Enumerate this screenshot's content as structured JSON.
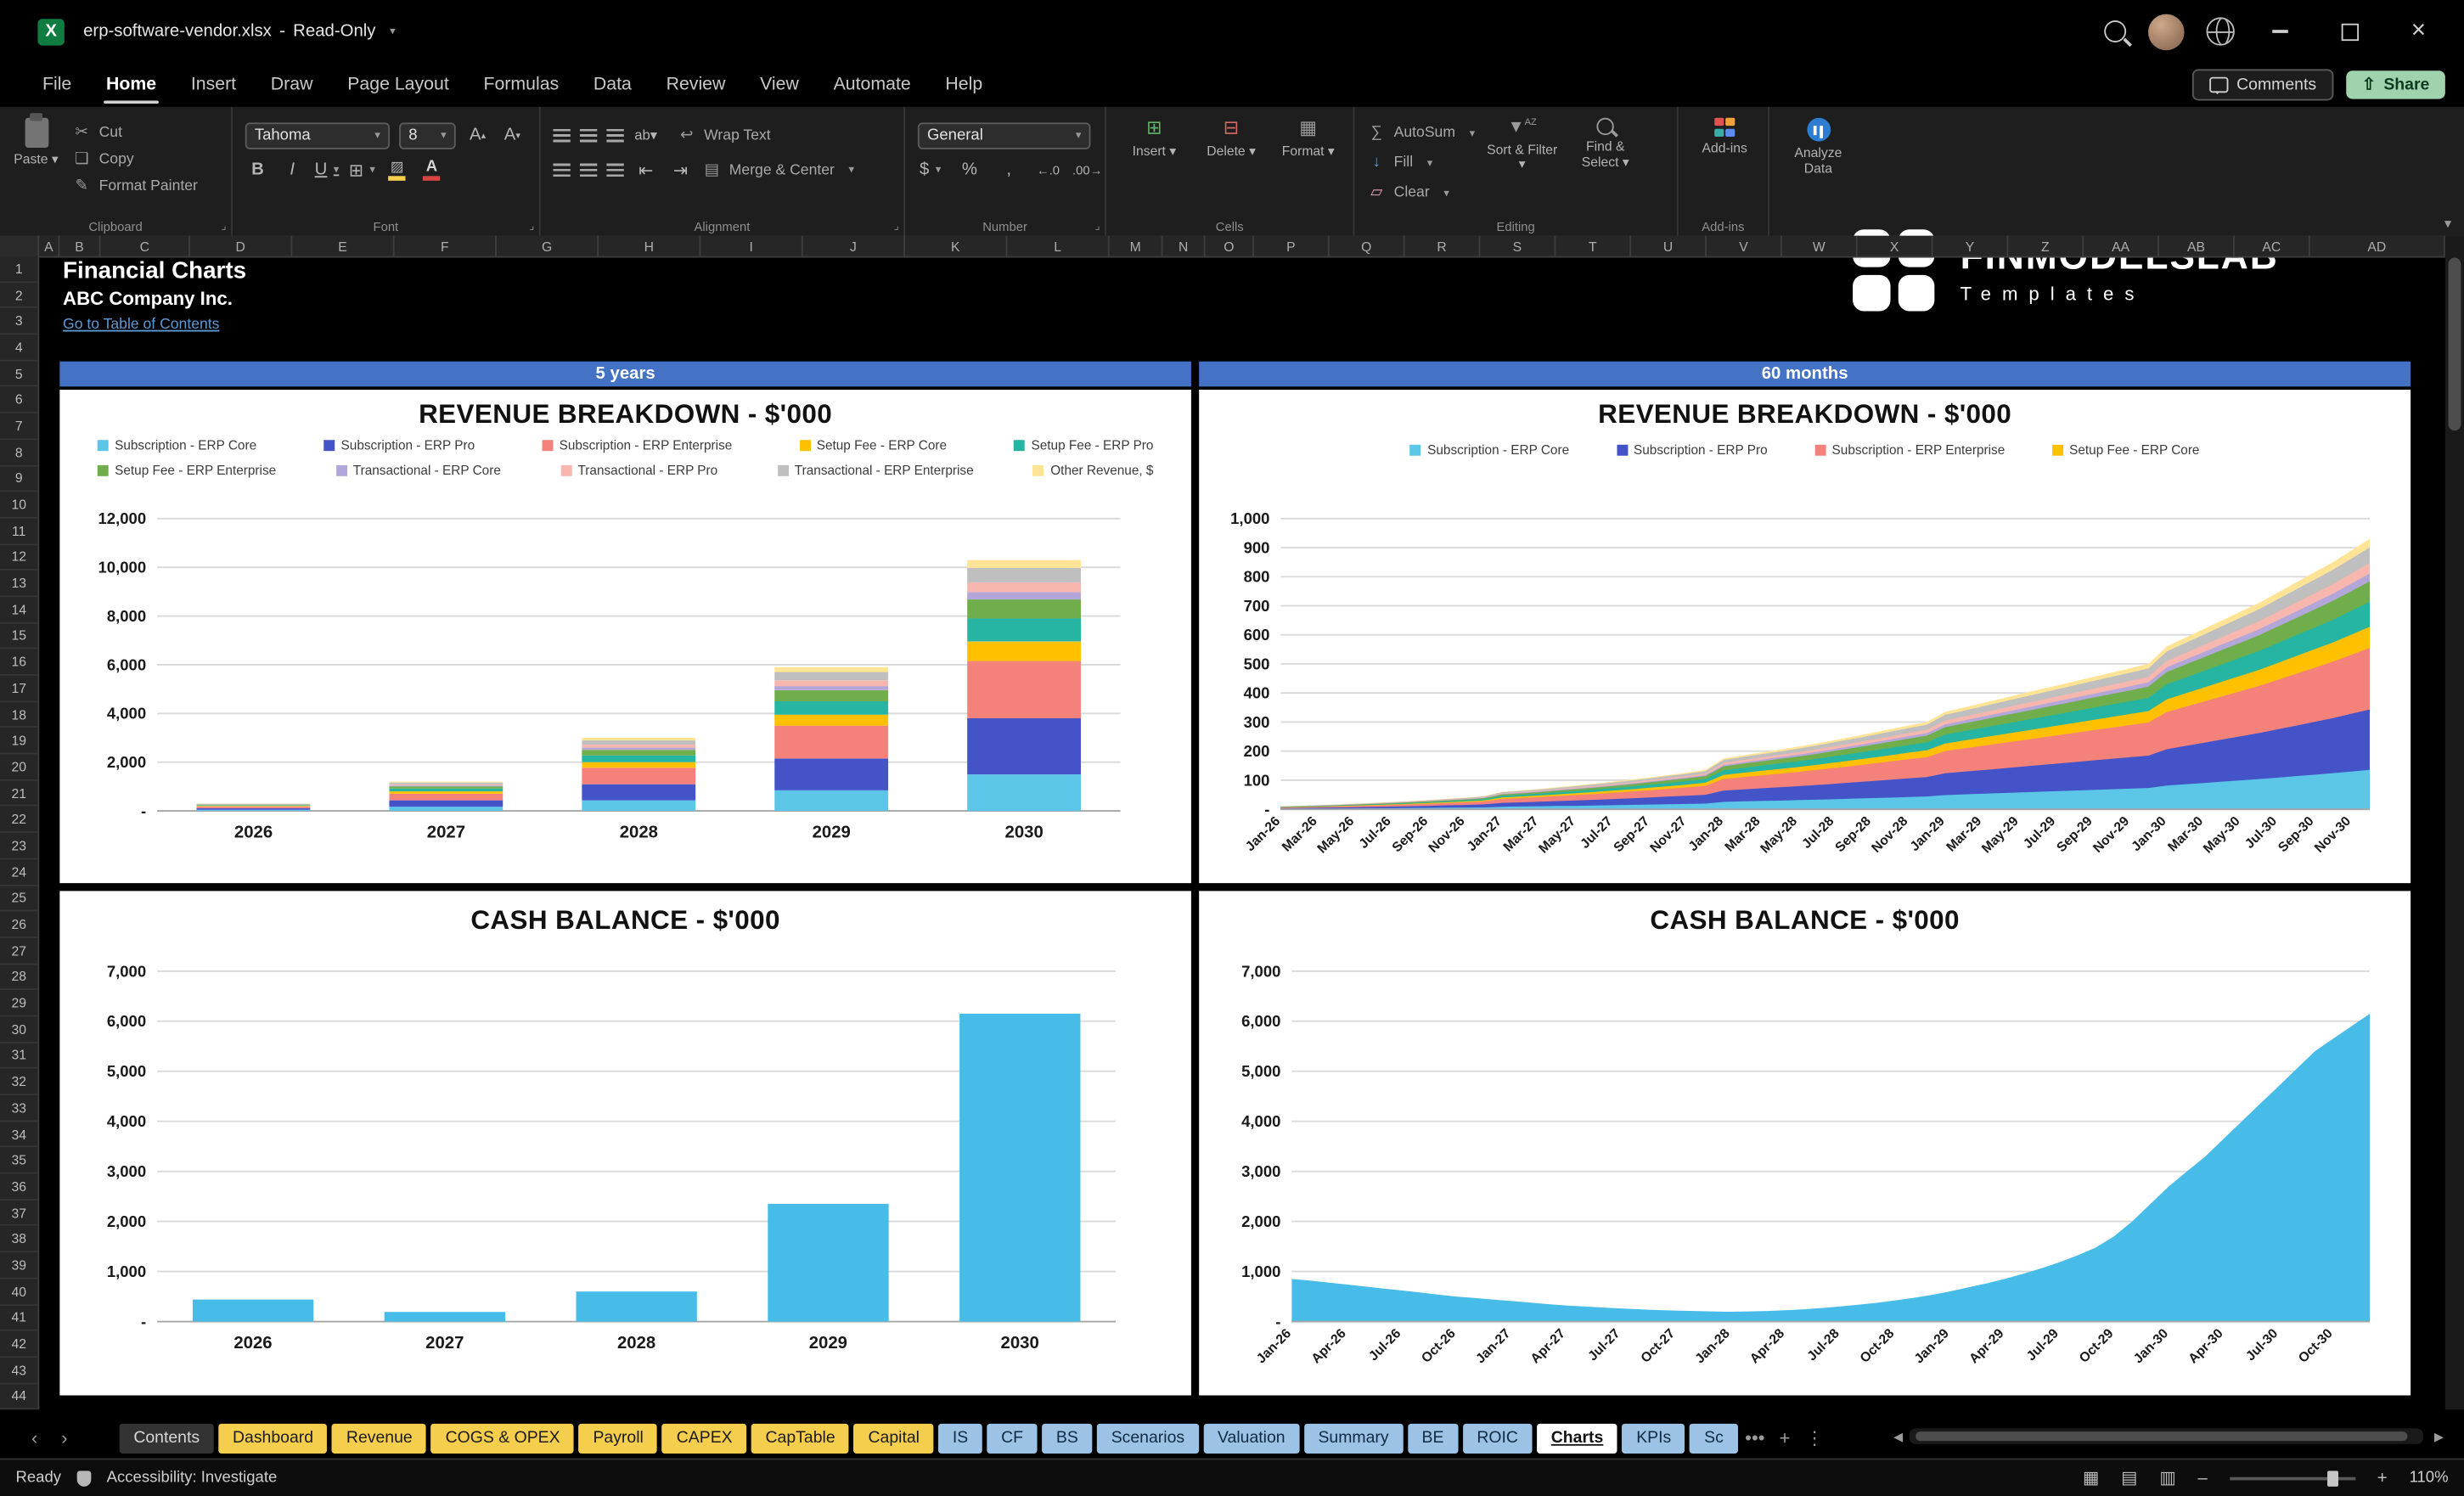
{
  "window": {
    "file": "erp-software-vendor.xlsx",
    "separator": "-",
    "mode": "Read-Only"
  },
  "menu": {
    "tabs": [
      "File",
      "Home",
      "Insert",
      "Draw",
      "Page Layout",
      "Formulas",
      "Data",
      "Review",
      "View",
      "Automate",
      "Help"
    ],
    "active": "Home",
    "comments_label": "Comments",
    "share_label": "Share"
  },
  "ribbon": {
    "paste": "Paste",
    "cut": "Cut",
    "copy": "Copy",
    "format_painter": "Format Painter",
    "font_name": "Tahoma",
    "font_size": "8",
    "wrap_text": "Wrap Text",
    "merge_center": "Merge & Center",
    "number_format": "General",
    "insert": "Insert",
    "delete": "Delete",
    "format": "Format",
    "autosum": "AutoSum",
    "fill": "Fill",
    "clear": "Clear",
    "sort_filter": "Sort & Filter",
    "find_select": "Find & Select",
    "addins": "Add-ins",
    "analyze_data": "Analyze Data",
    "groups": {
      "clipboard": "Clipboard",
      "font": "Font",
      "alignment": "Alignment",
      "number": "Number",
      "cells": "Cells",
      "editing": "Editing",
      "addins": "Add-ins"
    }
  },
  "logo": {
    "name": "FINMODELSLAB",
    "tagline": "Templates"
  },
  "grid": {
    "columns": [
      "A",
      "B",
      "C",
      "D",
      "E",
      "F",
      "G",
      "H",
      "I",
      "J",
      "K",
      "L",
      "M",
      "N",
      "O",
      "P",
      "Q",
      "R",
      "S",
      "T",
      "U",
      "V",
      "W",
      "X",
      "Y",
      "Z",
      "AA",
      "AB",
      "AC",
      "AD"
    ],
    "row_first": 1,
    "row_last": 44,
    "title": "Financial Charts",
    "company": "ABC Company Inc.",
    "link": "Go to Table of Contents",
    "banner_left": "5 years",
    "banner_right": "60 months"
  },
  "sheet_tabs": {
    "tabs": [
      {
        "label": "Contents",
        "style": "dark"
      },
      {
        "label": "Dashboard",
        "style": "yellow"
      },
      {
        "label": "Revenue",
        "style": "yellow"
      },
      {
        "label": "COGS & OPEX",
        "style": "yellow"
      },
      {
        "label": "Payroll",
        "style": "yellow"
      },
      {
        "label": "CAPEX",
        "style": "yellow"
      },
      {
        "label": "CapTable",
        "style": "yellow"
      },
      {
        "label": "Capital",
        "style": "yellow"
      },
      {
        "label": "IS",
        "style": "blue"
      },
      {
        "label": "CF",
        "style": "blue"
      },
      {
        "label": "BS",
        "style": "blue"
      },
      {
        "label": "Scenarios",
        "style": "blue"
      },
      {
        "label": "Valuation",
        "style": "blue"
      },
      {
        "label": "Summary",
        "style": "blue"
      },
      {
        "label": "BE",
        "style": "blue"
      },
      {
        "label": "ROIC",
        "style": "blue"
      },
      {
        "label": "Charts",
        "style": "active"
      },
      {
        "label": "KPIs",
        "style": "blue"
      },
      {
        "label": "Sc",
        "style": "blue"
      }
    ]
  },
  "status": {
    "ready": "Ready",
    "accessibility": "Accessibility: Investigate",
    "zoom": "110%"
  },
  "chart_data": [
    {
      "type": "bar",
      "stacked": true,
      "title": "REVENUE BREAKDOWN - $'000",
      "categories": [
        "2026",
        "2027",
        "2028",
        "2029",
        "2030"
      ],
      "ylim": [
        0,
        12000
      ],
      "ystep": 2000,
      "grid": true,
      "legend_position": "top",
      "series": [
        {
          "name": "Subscription - ERP Core",
          "color": "#5BC6E8",
          "legend_row": 0,
          "values": [
            45,
            170,
            430,
            850,
            1500
          ]
        },
        {
          "name": "Subscription - ERP Pro",
          "color": "#4454C8",
          "legend_row": 0,
          "values": [
            65,
            265,
            660,
            1300,
            2300
          ]
        },
        {
          "name": "Subscription - ERP Enterprise",
          "color": "#F4827B",
          "legend_row": 0,
          "values": [
            70,
            270,
            680,
            1350,
            2350
          ]
        },
        {
          "name": "Setup Fee - ERP Core",
          "color": "#FFC000",
          "legend_row": 0,
          "values": [
            25,
            95,
            230,
            450,
            800
          ]
        },
        {
          "name": "Setup Fee - ERP Pro",
          "color": "#27B5A3",
          "legend_row": 0,
          "values": [
            28,
            115,
            280,
            550,
            950
          ]
        },
        {
          "name": "Setup Fee - ERP Enterprise",
          "color": "#6FAE4B",
          "legend_row": 1,
          "values": [
            22,
            90,
            225,
            450,
            780
          ]
        },
        {
          "name": "Transactional - ERP Core",
          "color": "#B3A6D9",
          "legend_row": 1,
          "values": [
            9,
            36,
            90,
            170,
            300
          ]
        },
        {
          "name": "Transactional - ERP Pro",
          "color": "#F7B6AE",
          "legend_row": 1,
          "values": [
            12,
            48,
            120,
            230,
            400
          ]
        },
        {
          "name": "Transactional - ERP Enterprise",
          "color": "#BFBFBF",
          "legend_row": 1,
          "values": [
            17,
            72,
            175,
            350,
            600
          ]
        },
        {
          "name": "Other Revenue, $",
          "color": "#FFE496",
          "legend_row": 1,
          "values": [
            7,
            39,
            110,
            200,
            320
          ]
        }
      ]
    },
    {
      "type": "area",
      "stacked": true,
      "title": "REVENUE BREAKDOWN - $'000",
      "legend_visible": [
        "Subscription - ERP Core",
        "Subscription - ERP Pro",
        "Subscription - ERP Enterprise",
        "Setup Fee - ERP Core"
      ],
      "ylim": [
        0,
        1000
      ],
      "ystep": 100,
      "grid": true,
      "tick_every": 2,
      "x": [
        "Jan-26",
        "Feb-26",
        "Mar-26",
        "Apr-26",
        "May-26",
        "Jun-26",
        "Jul-26",
        "Aug-26",
        "Sep-26",
        "Oct-26",
        "Nov-26",
        "Dec-26",
        "Jan-27",
        "Feb-27",
        "Mar-27",
        "Apr-27",
        "May-27",
        "Jun-27",
        "Jul-27",
        "Aug-27",
        "Sep-27",
        "Oct-27",
        "Nov-27",
        "Dec-27",
        "Jan-28",
        "Feb-28",
        "Mar-28",
        "Apr-28",
        "May-28",
        "Jun-28",
        "Jul-28",
        "Aug-28",
        "Sep-28",
        "Oct-28",
        "Nov-28",
        "Dec-28",
        "Jan-29",
        "Feb-29",
        "Mar-29",
        "Apr-29",
        "May-29",
        "Jun-29",
        "Jul-29",
        "Aug-29",
        "Sep-29",
        "Oct-29",
        "Nov-29",
        "Dec-29",
        "Jan-30",
        "Feb-30",
        "Mar-30",
        "Apr-30",
        "May-30",
        "Jun-30",
        "Jul-30",
        "Aug-30",
        "Sep-30",
        "Oct-30",
        "Nov-30",
        "Dec-30"
      ],
      "totals": [
        10,
        12,
        14,
        16,
        19,
        22,
        25,
        28,
        32,
        36,
        40,
        45,
        60,
        65,
        70,
        76,
        82,
        88,
        95,
        102,
        110,
        118,
        126,
        135,
        175,
        185,
        195,
        205,
        215,
        226,
        238,
        250,
        262,
        275,
        288,
        300,
        335,
        350,
        365,
        380,
        395,
        410,
        425,
        440,
        455,
        470,
        485,
        500,
        560,
        590,
        620,
        650,
        680,
        710,
        745,
        780,
        815,
        850,
        890,
        930
      ],
      "series": [
        {
          "name": "Subscription - ERP Core",
          "color": "#5BC6E8",
          "share": 0.146
        },
        {
          "name": "Subscription - ERP Pro",
          "color": "#4454C8",
          "share": 0.223
        },
        {
          "name": "Subscription - ERP Enterprise",
          "color": "#F4827B",
          "share": 0.228
        },
        {
          "name": "Setup Fee - ERP Core",
          "color": "#FFC000",
          "share": 0.078
        },
        {
          "name": "Setup Fee - ERP Pro",
          "color": "#27B5A3",
          "share": 0.092
        },
        {
          "name": "Setup Fee - ERP Enterprise",
          "color": "#6FAE4B",
          "share": 0.076
        },
        {
          "name": "Transactional - ERP Core",
          "color": "#B3A6D9",
          "share": 0.029
        },
        {
          "name": "Transactional - ERP Pro",
          "color": "#F7B6AE",
          "share": 0.039
        },
        {
          "name": "Transactional - ERP Enterprise",
          "color": "#BFBFBF",
          "share": 0.058
        },
        {
          "name": "Other Revenue, $",
          "color": "#FFE496",
          "share": 0.031
        }
      ]
    },
    {
      "type": "bar",
      "title": "CASH BALANCE - $'000",
      "categories": [
        "2026",
        "2027",
        "2028",
        "2029",
        "2030"
      ],
      "values": [
        440,
        190,
        600,
        2350,
        6150
      ],
      "color": "#47BCE8",
      "ylim": [
        0,
        7000
      ],
      "ystep": 1000,
      "grid": true
    },
    {
      "type": "area",
      "title": "CASH BALANCE - $'000",
      "color": "#47BCE8",
      "ylim": [
        0,
        7000
      ],
      "ystep": 1000,
      "grid": true,
      "tick_every": 3,
      "x": [
        "Jan-26",
        "Feb-26",
        "Mar-26",
        "Apr-26",
        "May-26",
        "Jun-26",
        "Jul-26",
        "Aug-26",
        "Sep-26",
        "Oct-26",
        "Nov-26",
        "Dec-26",
        "Jan-27",
        "Feb-27",
        "Mar-27",
        "Apr-27",
        "May-27",
        "Jun-27",
        "Jul-27",
        "Aug-27",
        "Sep-27",
        "Oct-27",
        "Nov-27",
        "Dec-27",
        "Jan-28",
        "Feb-28",
        "Mar-28",
        "Apr-28",
        "May-28",
        "Jun-28",
        "Jul-28",
        "Aug-28",
        "Sep-28",
        "Oct-28",
        "Nov-28",
        "Dec-28",
        "Jan-29",
        "Feb-29",
        "Mar-29",
        "Apr-29",
        "May-29",
        "Jun-29",
        "Jul-29",
        "Aug-29",
        "Sep-29",
        "Oct-29",
        "Nov-29",
        "Dec-29",
        "Jan-30",
        "Feb-30",
        "Mar-30",
        "Apr-30",
        "May-30",
        "Jun-30",
        "Jul-30",
        "Aug-30",
        "Sep-30",
        "Oct-30",
        "Nov-30",
        "Dec-30"
      ],
      "values": [
        850,
        820,
        780,
        740,
        700,
        660,
        620,
        580,
        540,
        500,
        470,
        440,
        410,
        380,
        350,
        320,
        300,
        280,
        260,
        245,
        230,
        220,
        210,
        200,
        195,
        200,
        210,
        225,
        245,
        270,
        300,
        335,
        375,
        420,
        470,
        530,
        600,
        680,
        760,
        850,
        950,
        1060,
        1180,
        1320,
        1480,
        1700,
        2000,
        2350,
        2700,
        3000,
        3300,
        3650,
        4000,
        4350,
        4700,
        5050,
        5400,
        5650,
        5900,
        6150
      ]
    }
  ]
}
